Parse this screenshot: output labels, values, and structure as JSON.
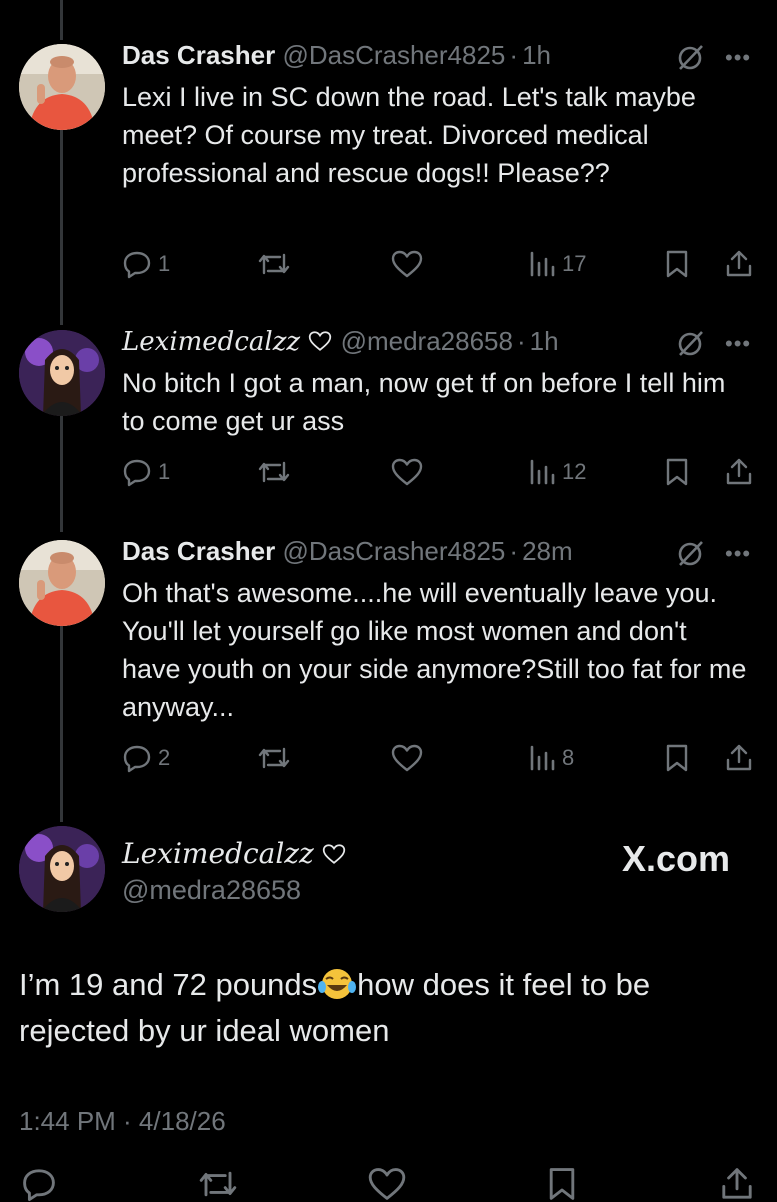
{
  "replies": [
    {
      "display_name": "Das Crasher",
      "handle": "@DasCrasher4825",
      "separator": "·",
      "time": "1h",
      "text": "Lexi I live in SC down the road. Let's talk maybe meet? Of course my treat. Divorced medical professional and rescue dogs!! Please??",
      "reply_count": "1",
      "views": "17",
      "avatar": "man-in-red-shirt"
    },
    {
      "display_name": "Leximedcalzz",
      "handle": "@medra28658",
      "separator": "·",
      "time": "1h",
      "text": "No bitch I got a man, now get tf on before I tell him to come get ur ass",
      "reply_count": "1",
      "views": "12",
      "avatar": "cartoon-girl"
    },
    {
      "display_name": "Das Crasher",
      "handle": "@DasCrasher4825",
      "separator": "·",
      "time": "28m",
      "text": "Oh that's awesome....he will eventually leave you. You'll let yourself go like most women and don't have youth on your side anymore?Still too fat for me anyway...",
      "reply_count": "2",
      "views": "8",
      "avatar": "man-in-red-shirt"
    }
  ],
  "main_post": {
    "display_name": "Leximedcalzz",
    "handle": "@medra28658",
    "text_before_emoji": "I’m 19 and 72 pounds",
    "text_after_emoji": "how does it feel to be rejected by ur ideal women",
    "emoji": "laughing-crying-emoji",
    "timestamp": "1:44 PM · 4/18/26",
    "watermark": "X.com"
  },
  "colors": {
    "background": "#000000",
    "text": "#e7e9ea",
    "secondary": "#71767b",
    "thread_line": "#333639"
  }
}
